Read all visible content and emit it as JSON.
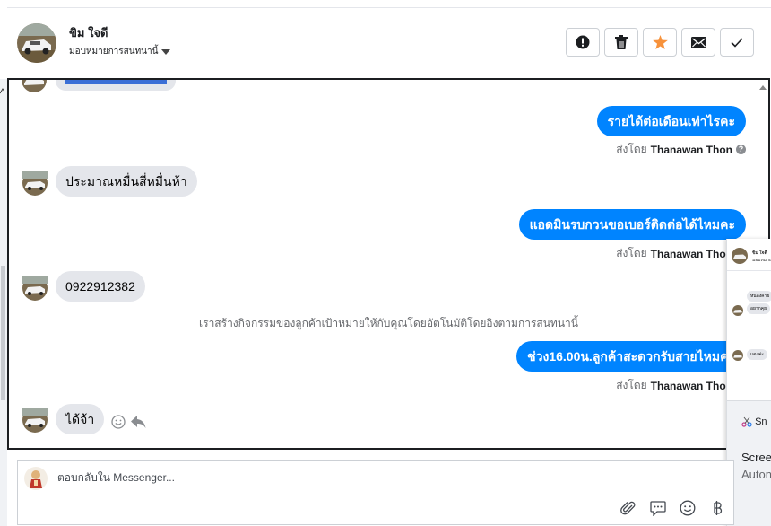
{
  "header": {
    "contact_name": "ขิม ใจดี",
    "assign_label": "มอบหมายการสนทนานี้",
    "actions": [
      {
        "name": "report-button",
        "icon": "alert-icon"
      },
      {
        "name": "delete-button",
        "icon": "trash-icon"
      },
      {
        "name": "star-button",
        "icon": "star-icon"
      },
      {
        "name": "mark-unread-button",
        "icon": "envelope-icon"
      },
      {
        "name": "mark-done-button",
        "icon": "check-icon"
      }
    ]
  },
  "chat": {
    "messages": [
      {
        "dir": "out",
        "text": "รายได้ต่อเดือนเท่าไรคะ"
      },
      {
        "dir": "in",
        "text": "ประมาณหมื่นสี่หมื่นห้า"
      },
      {
        "dir": "out",
        "text": "แอดมินรบกวนขอเบอร์ติดต่อได้ไหมคะ"
      },
      {
        "dir": "in",
        "text": "0922912382"
      },
      {
        "dir": "out",
        "text": "ช่วง16.00น.ลูกค้าสะดวกรับสายไหมคะ"
      },
      {
        "dir": "in",
        "text": "ได้จ้า"
      }
    ],
    "sent_by_prefix": "ส่งโดย",
    "sent_by_name": "Thanawan Thon",
    "system_note": "เราสร้างกิจกรรมของลูกค้าเป้าหมายให้กับคุณโดยอัตโนมัติโดยอิงตามการสนทนานี้"
  },
  "thumbnail": {
    "name": "ขิม ใจดี",
    "assign": "มอบหมายการ",
    "bubble_1": "หนองคาย",
    "bubble_2": "อยากคุย",
    "bubble_3": "แดงค่ะ",
    "snip_label": "Sn",
    "scree_label": "Scree",
    "auton_label": "Auton"
  },
  "composer": {
    "placeholder": "ตอบกลับใน Messenger...",
    "tools": [
      "attach-icon",
      "saved-reply-icon",
      "emoji-icon",
      "baht-icon"
    ]
  },
  "colors": {
    "accent": "#0084ff",
    "incoming_bubble": "#e4e6eb",
    "star": "#f7923b"
  }
}
